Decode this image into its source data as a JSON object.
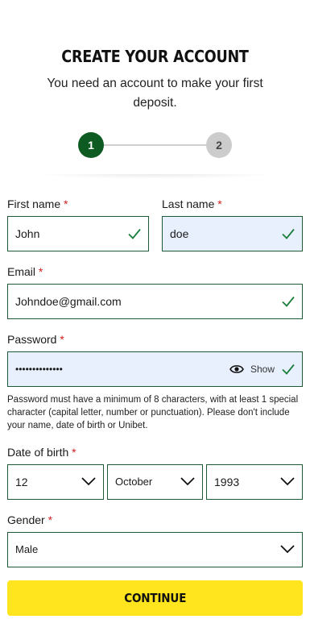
{
  "header": {
    "title": "CREATE YOUR ACCOUNT",
    "subtitle": "You need an account to make your first deposit."
  },
  "stepper": {
    "steps": [
      "1",
      "2"
    ],
    "current": 1
  },
  "form": {
    "first_name": {
      "label": "First name",
      "required": "*",
      "value": "John"
    },
    "last_name": {
      "label": "Last name",
      "required": "*",
      "value": "doe"
    },
    "email": {
      "label": "Email",
      "required": "*",
      "value": "Johndoe@gmail.com"
    },
    "password": {
      "label": "Password",
      "required": "*",
      "value": "••••••••••••••",
      "show_label": "Show",
      "hint": "Password must have a minimum of 8 characters, with at least 1 special character (capital letter, number or punctuation). Please don't include your name, date of birth or Unibet."
    },
    "dob": {
      "label": "Date of birth",
      "required": "*",
      "day": "12",
      "month": "October",
      "year": "1993"
    },
    "gender": {
      "label": "Gender",
      "required": "*",
      "value": "Male"
    }
  },
  "actions": {
    "continue_label": "CONTINUE"
  },
  "colors": {
    "accent_green": "#0d5a23",
    "check_green": "#1a7f3c",
    "button_yellow": "#ffe51d",
    "required_red": "#d21d1d"
  }
}
